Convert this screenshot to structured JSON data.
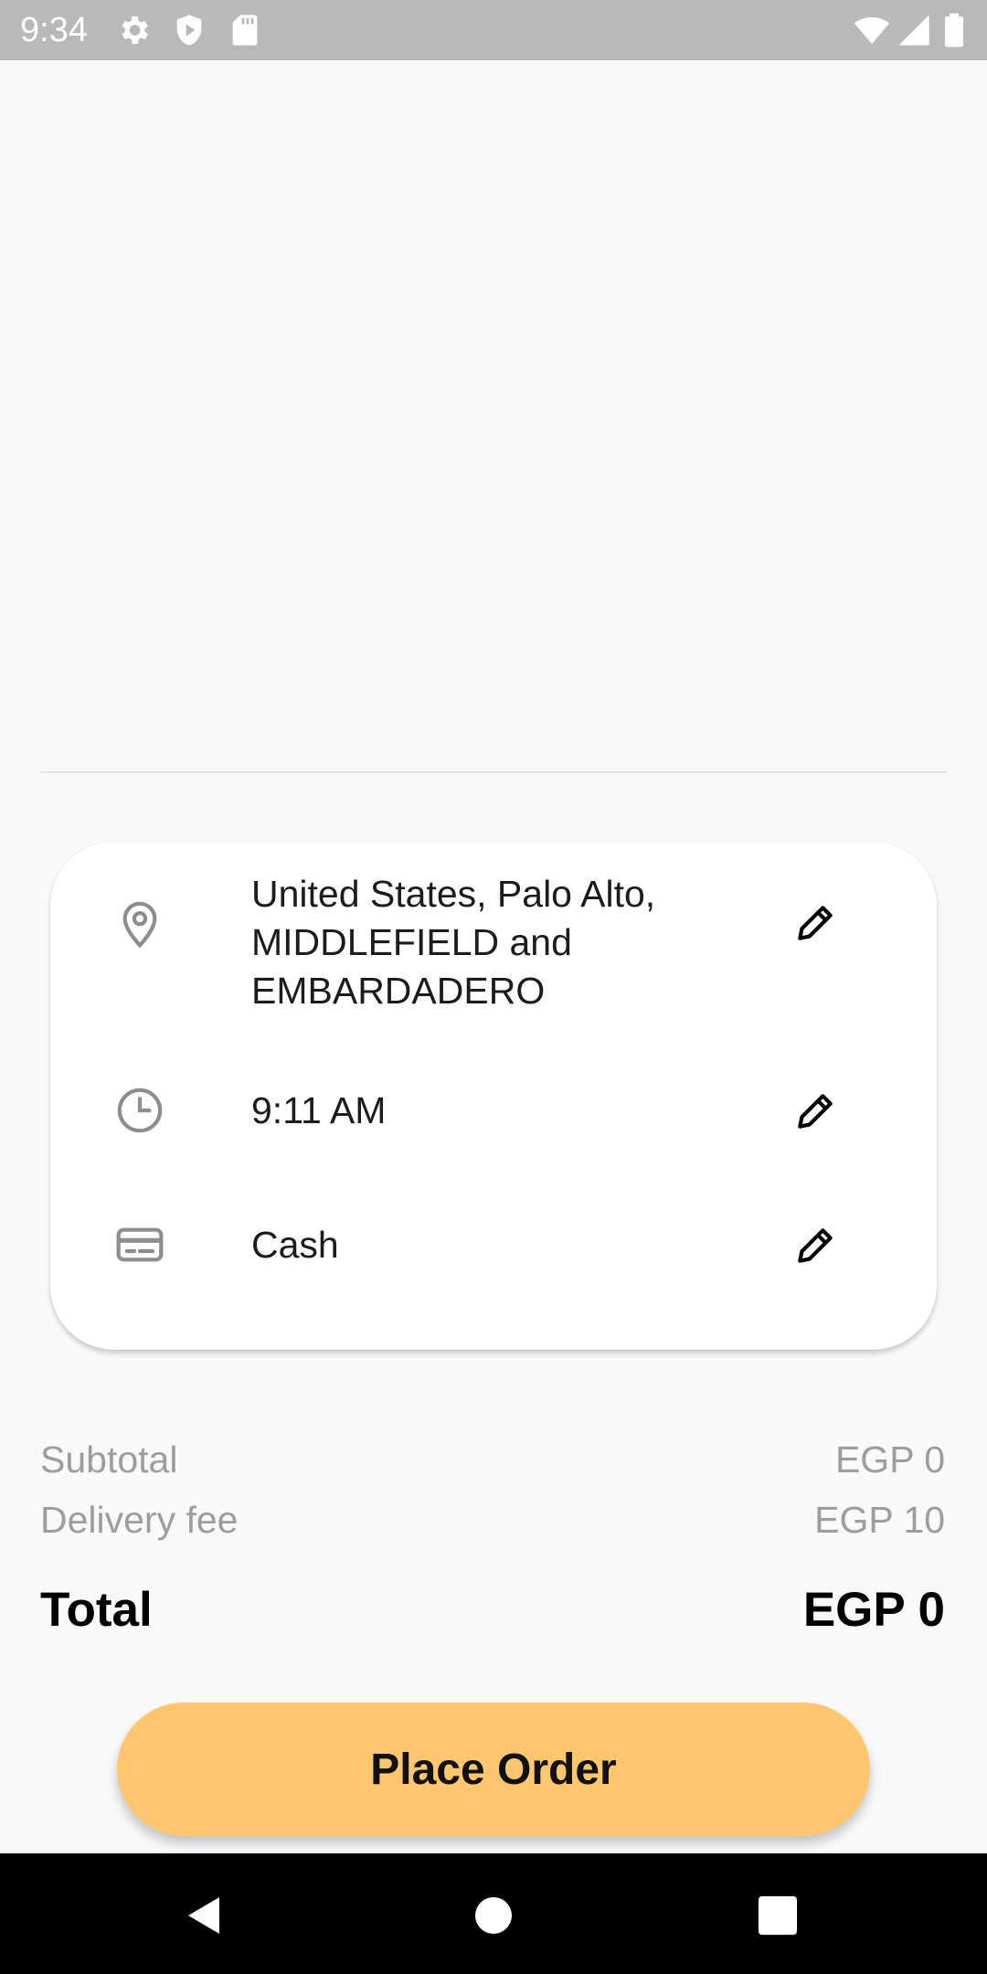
{
  "status_bar": {
    "time": "9:34",
    "left_icons": [
      "gear-icon",
      "shield-play-icon",
      "sd-card-icon"
    ],
    "right_icons": [
      "wifi-icon",
      "cell-signal-icon",
      "battery-icon"
    ]
  },
  "order_details": {
    "address": {
      "icon": "location-pin-icon",
      "line1": "United States, Palo Alto,",
      "line2": "MIDDLEFIELD and",
      "line3": "EMBARDADERO"
    },
    "time": {
      "icon": "clock-icon",
      "value": "9:11 AM"
    },
    "payment": {
      "icon": "credit-card-icon",
      "value": "Cash"
    }
  },
  "summary": {
    "subtotal_label": "Subtotal",
    "subtotal_value": "EGP 0",
    "delivery_label": "Delivery fee",
    "delivery_value": "EGP 10",
    "total_label": "Total",
    "total_value": "EGP 0"
  },
  "actions": {
    "place_order_label": "Place Order"
  },
  "colors": {
    "accent": "#fec66e",
    "background": "#f9f9f9",
    "muted_text": "#9d9d9d",
    "status_bar": "#b9b9b9"
  }
}
